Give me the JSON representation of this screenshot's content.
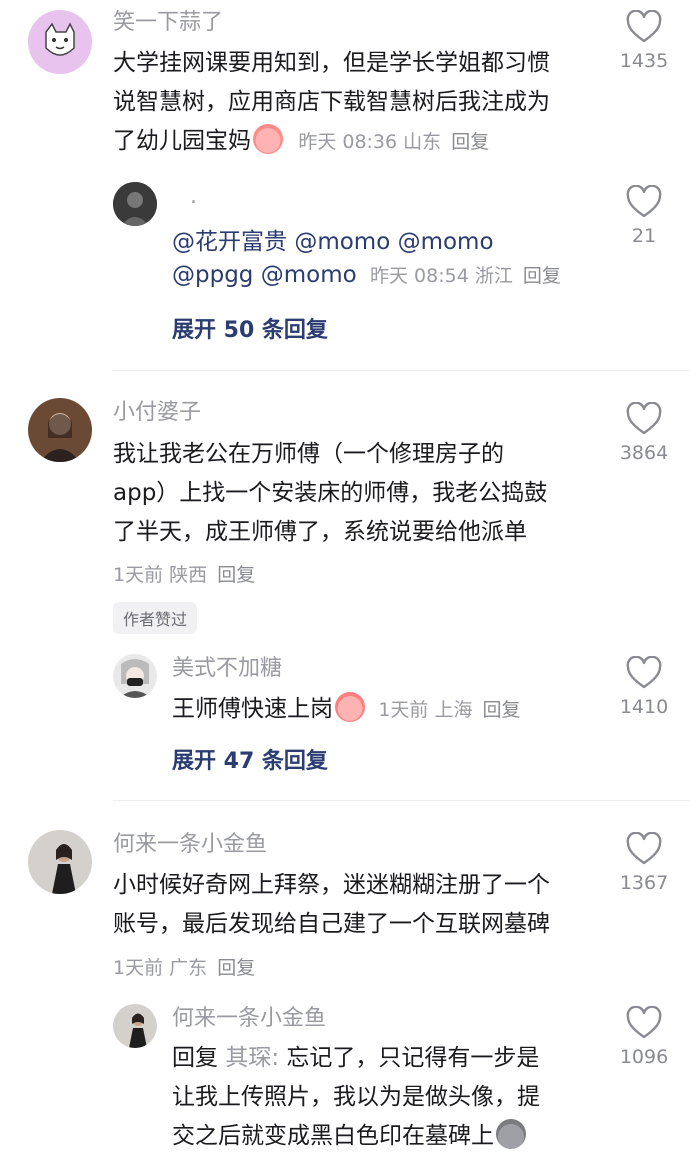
{
  "colors": {
    "name": "#9a9ba2",
    "link": "#2b3c70",
    "divider": "#eeeef0"
  },
  "comments": [
    {
      "user": "笑一下蒜了",
      "text_lines": [
        "大学挂网课要用知到，但是学长学姐都习惯",
        "说智慧树，应用商店下载智慧树后我注成为",
        "了幼儿园宝妈"
      ],
      "time": "昨天 08:36",
      "location": "山东",
      "reply_label": "回复",
      "likes": "1435",
      "reply": {
        "user": ".",
        "line1_links": [
          "@花开富贵",
          "@momo",
          "@momo"
        ],
        "line2_links": [
          "@ppgg",
          "@momo"
        ],
        "time": "昨天 08:54",
        "location": "浙江",
        "reply_label": "回复",
        "likes": "21"
      },
      "expand": "展开 50 条回复"
    },
    {
      "user": "小付婆子",
      "text_lines": [
        "我让我老公在万师傅（一个修理房子的",
        "app）上找一个安装床的师傅，我老公捣鼓",
        "了半天，成王师傅了，系统说要给他派单"
      ],
      "time": "1天前",
      "location": "陕西",
      "reply_label": "回复",
      "likes": "3864",
      "badge": "作者赞过",
      "reply": {
        "user": "美式不加糖",
        "text": "王师傅快速上岗",
        "time": "1天前",
        "location": "上海",
        "reply_label": "回复",
        "likes": "1410"
      },
      "expand": "展开 47 条回复"
    },
    {
      "user": "何来一条小金鱼",
      "text_lines": [
        "小时候好奇网上拜祭，迷迷糊糊注册了一个",
        "账号，最后发现给自己建了一个互联网墓碑"
      ],
      "time": "1天前",
      "location": "广东",
      "reply_label": "回复",
      "likes": "1367",
      "reply": {
        "user": "何来一条小金鱼",
        "reply_prefix": "回复",
        "reply_to": "其琛:",
        "text_lines": [
          "忘记了，只记得有一步是",
          "让我上传照片，我以为是做头像，提",
          "交之后就变成黑白色印在墓碑上"
        ],
        "likes": "1096"
      }
    }
  ],
  "icons": {
    "like": "heart-outline-icon"
  }
}
